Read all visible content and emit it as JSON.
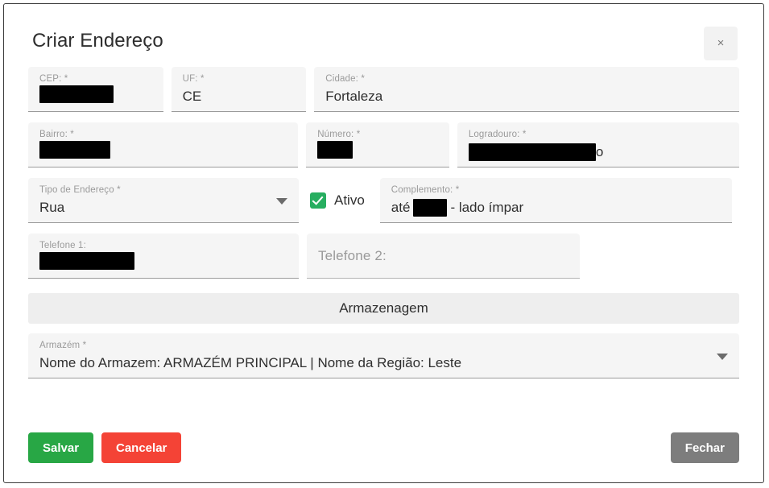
{
  "dialog": {
    "title": "Criar Endereço",
    "close_icon_label": "×"
  },
  "fields": {
    "cep": {
      "label": "CEP: *",
      "value": "",
      "redacted": true,
      "redact_width": 92
    },
    "uf": {
      "label": "UF: *",
      "value": "CE",
      "redacted": false
    },
    "cidade": {
      "label": "Cidade: *",
      "value": "Fortaleza",
      "redacted": false
    },
    "bairro": {
      "label": "Bairro: *",
      "value": "",
      "redacted": true,
      "redact_width": 88
    },
    "numero": {
      "label": "Número: *",
      "value": "",
      "redacted": true,
      "redact_width": 44
    },
    "logradouro": {
      "label": "Logradouro: *",
      "value": "o",
      "redacted": true,
      "redact_width": 158
    },
    "tipo_endereco": {
      "label": "Tipo de Endereço *",
      "value": "Rua",
      "redacted": false
    },
    "complemento": {
      "label": "Complemento: *",
      "prefix": "até",
      "suffix": "- lado ímpar",
      "redacted": true,
      "redact_width": 42
    },
    "telefone1": {
      "label": "Telefone 1:",
      "value": "",
      "redacted": true,
      "redact_width": 118
    },
    "telefone2": {
      "label": "Telefone 2:",
      "value": "",
      "placeholder_only": true
    }
  },
  "checkbox": {
    "label": "Ativo",
    "checked": true
  },
  "section": {
    "armazenagem_title": "Armazenagem"
  },
  "armazem": {
    "label": "Armazém *",
    "value": "Nome do Armazem: ARMAZÉM PRINCIPAL | Nome da Região: Leste"
  },
  "footer": {
    "save_label": "Salvar",
    "cancel_label": "Cancelar",
    "close_label": "Fechar"
  },
  "colors": {
    "save_green": "#28a745",
    "cancel_red": "#f44336",
    "close_gray": "#7d7d7d",
    "checkbox_green": "#27ae60",
    "field_bg": "#f5f5f5",
    "section_bg": "#eeeeee"
  }
}
